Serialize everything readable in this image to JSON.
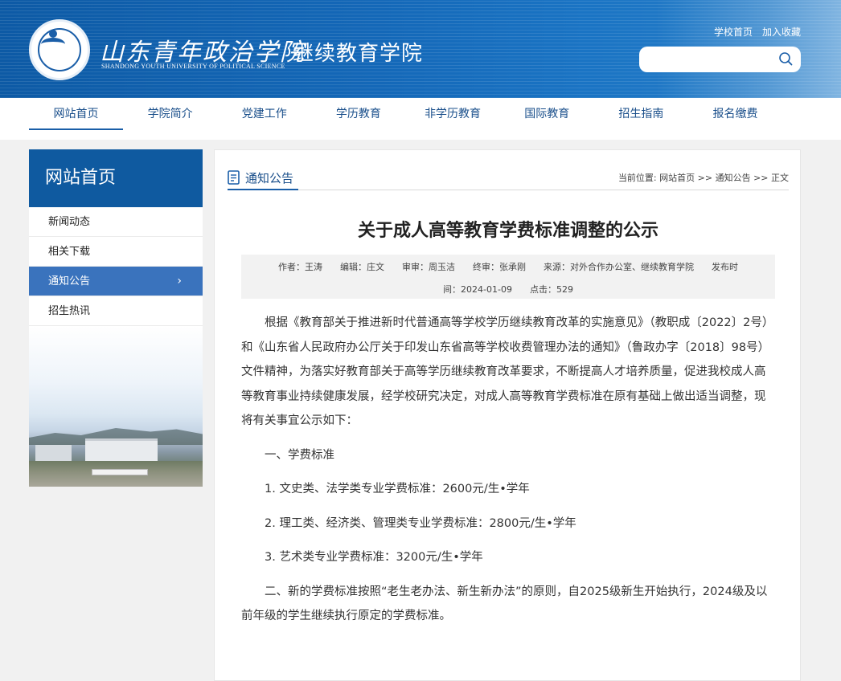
{
  "colors": {
    "primary": "#0f5aa0",
    "nav_text": "#1a4f8b",
    "sidebar_active": "#3a73bd"
  },
  "header": {
    "school_name": "山东青年政治学院",
    "school_name_en": "SHANDONG YOUTH UNIVERSITY OF POLITICAL SCIENCE",
    "college_name": "继续教育学院",
    "links": [
      "学校首页",
      "加入收藏"
    ],
    "search_placeholder": ""
  },
  "nav": {
    "items": [
      "网站首页",
      "学院简介",
      "党建工作",
      "学历教育",
      "非学历教育",
      "国际教育",
      "招生指南",
      "报名缴费"
    ],
    "active_index": 0
  },
  "sidebar": {
    "title": "网站首页",
    "items": [
      "新闻动态",
      "相关下载",
      "通知公告",
      "招生热讯"
    ],
    "active_index": 2,
    "active_chevron": "›"
  },
  "section": {
    "title": "通知公告",
    "breadcrumb": "当前位置: 网站首页 >> 通知公告 >> 正文"
  },
  "article": {
    "title": "关于成人高等教育学费标准调整的公示",
    "meta_line1": "作者：王涛　　编辑：庄文　　审审：周玉洁　　终审：张承刚　　来源：对外合作办公室、继续教育学院　　发布时",
    "meta_line2": "间：2024-01-09　　点击：529",
    "paragraphs": [
      "根据《教育部关于推进新时代普通高等学校学历继续教育改革的实施意见》（教职成〔2022〕2号）和《山东省人民政府办公厅关于印发山东省高等学校收费管理办法的通知》（鲁政办字〔2018〕98号）文件精神，为落实好教育部关于高等学历继续教育改革要求，不断提高人才培养质量，促进我校成人高等教育事业持续健康发展，经学校研究决定，对成人高等教育学费标准在原有基础上做出适当调整，现将有关事宜公示如下：",
      "一、学费标准",
      "1. 文史类、法学类专业学费标准：2600元/生•学年",
      "2. 理工类、经济类、管理类专业学费标准：2800元/生•学年",
      "3. 艺术类专业学费标准：3200元/生•学年",
      "二、新的学费标准按照“老生老办法、新生新办法”的原则，自2025级新生开始执行，2024级及以前年级的学生继续执行原定的学费标准。"
    ]
  }
}
